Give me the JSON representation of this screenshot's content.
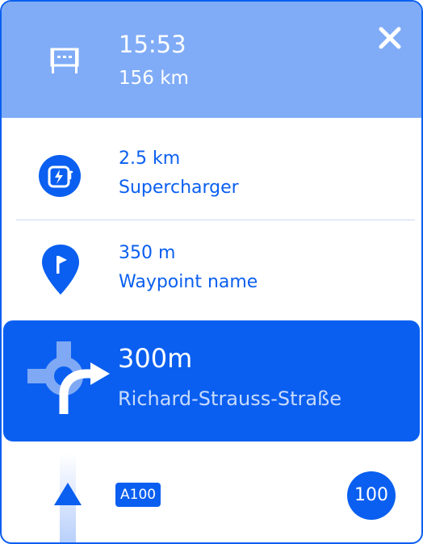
{
  "header": {
    "eta": "15:53",
    "remaining_distance": "156 km",
    "icon": "finish-flag-icon",
    "close_icon": "close-icon"
  },
  "stops": [
    {
      "distance": "2.5 km",
      "name": "Supercharger",
      "icon": "supercharger-icon"
    },
    {
      "distance": "350 m",
      "name": "Waypoint name",
      "icon": "waypoint-pin-icon"
    }
  ],
  "maneuver": {
    "distance": "300m",
    "street": "Richard-Strauss-Straße",
    "icon": "roundabout-right-turn-icon"
  },
  "lane": {
    "road_badge": "A100",
    "speed_limit": "100",
    "icon": "straight-arrow-icon"
  },
  "colors": {
    "primary": "#0a5ff0",
    "header_bg": "#80acf7",
    "street_text": "#c8dbfd"
  }
}
